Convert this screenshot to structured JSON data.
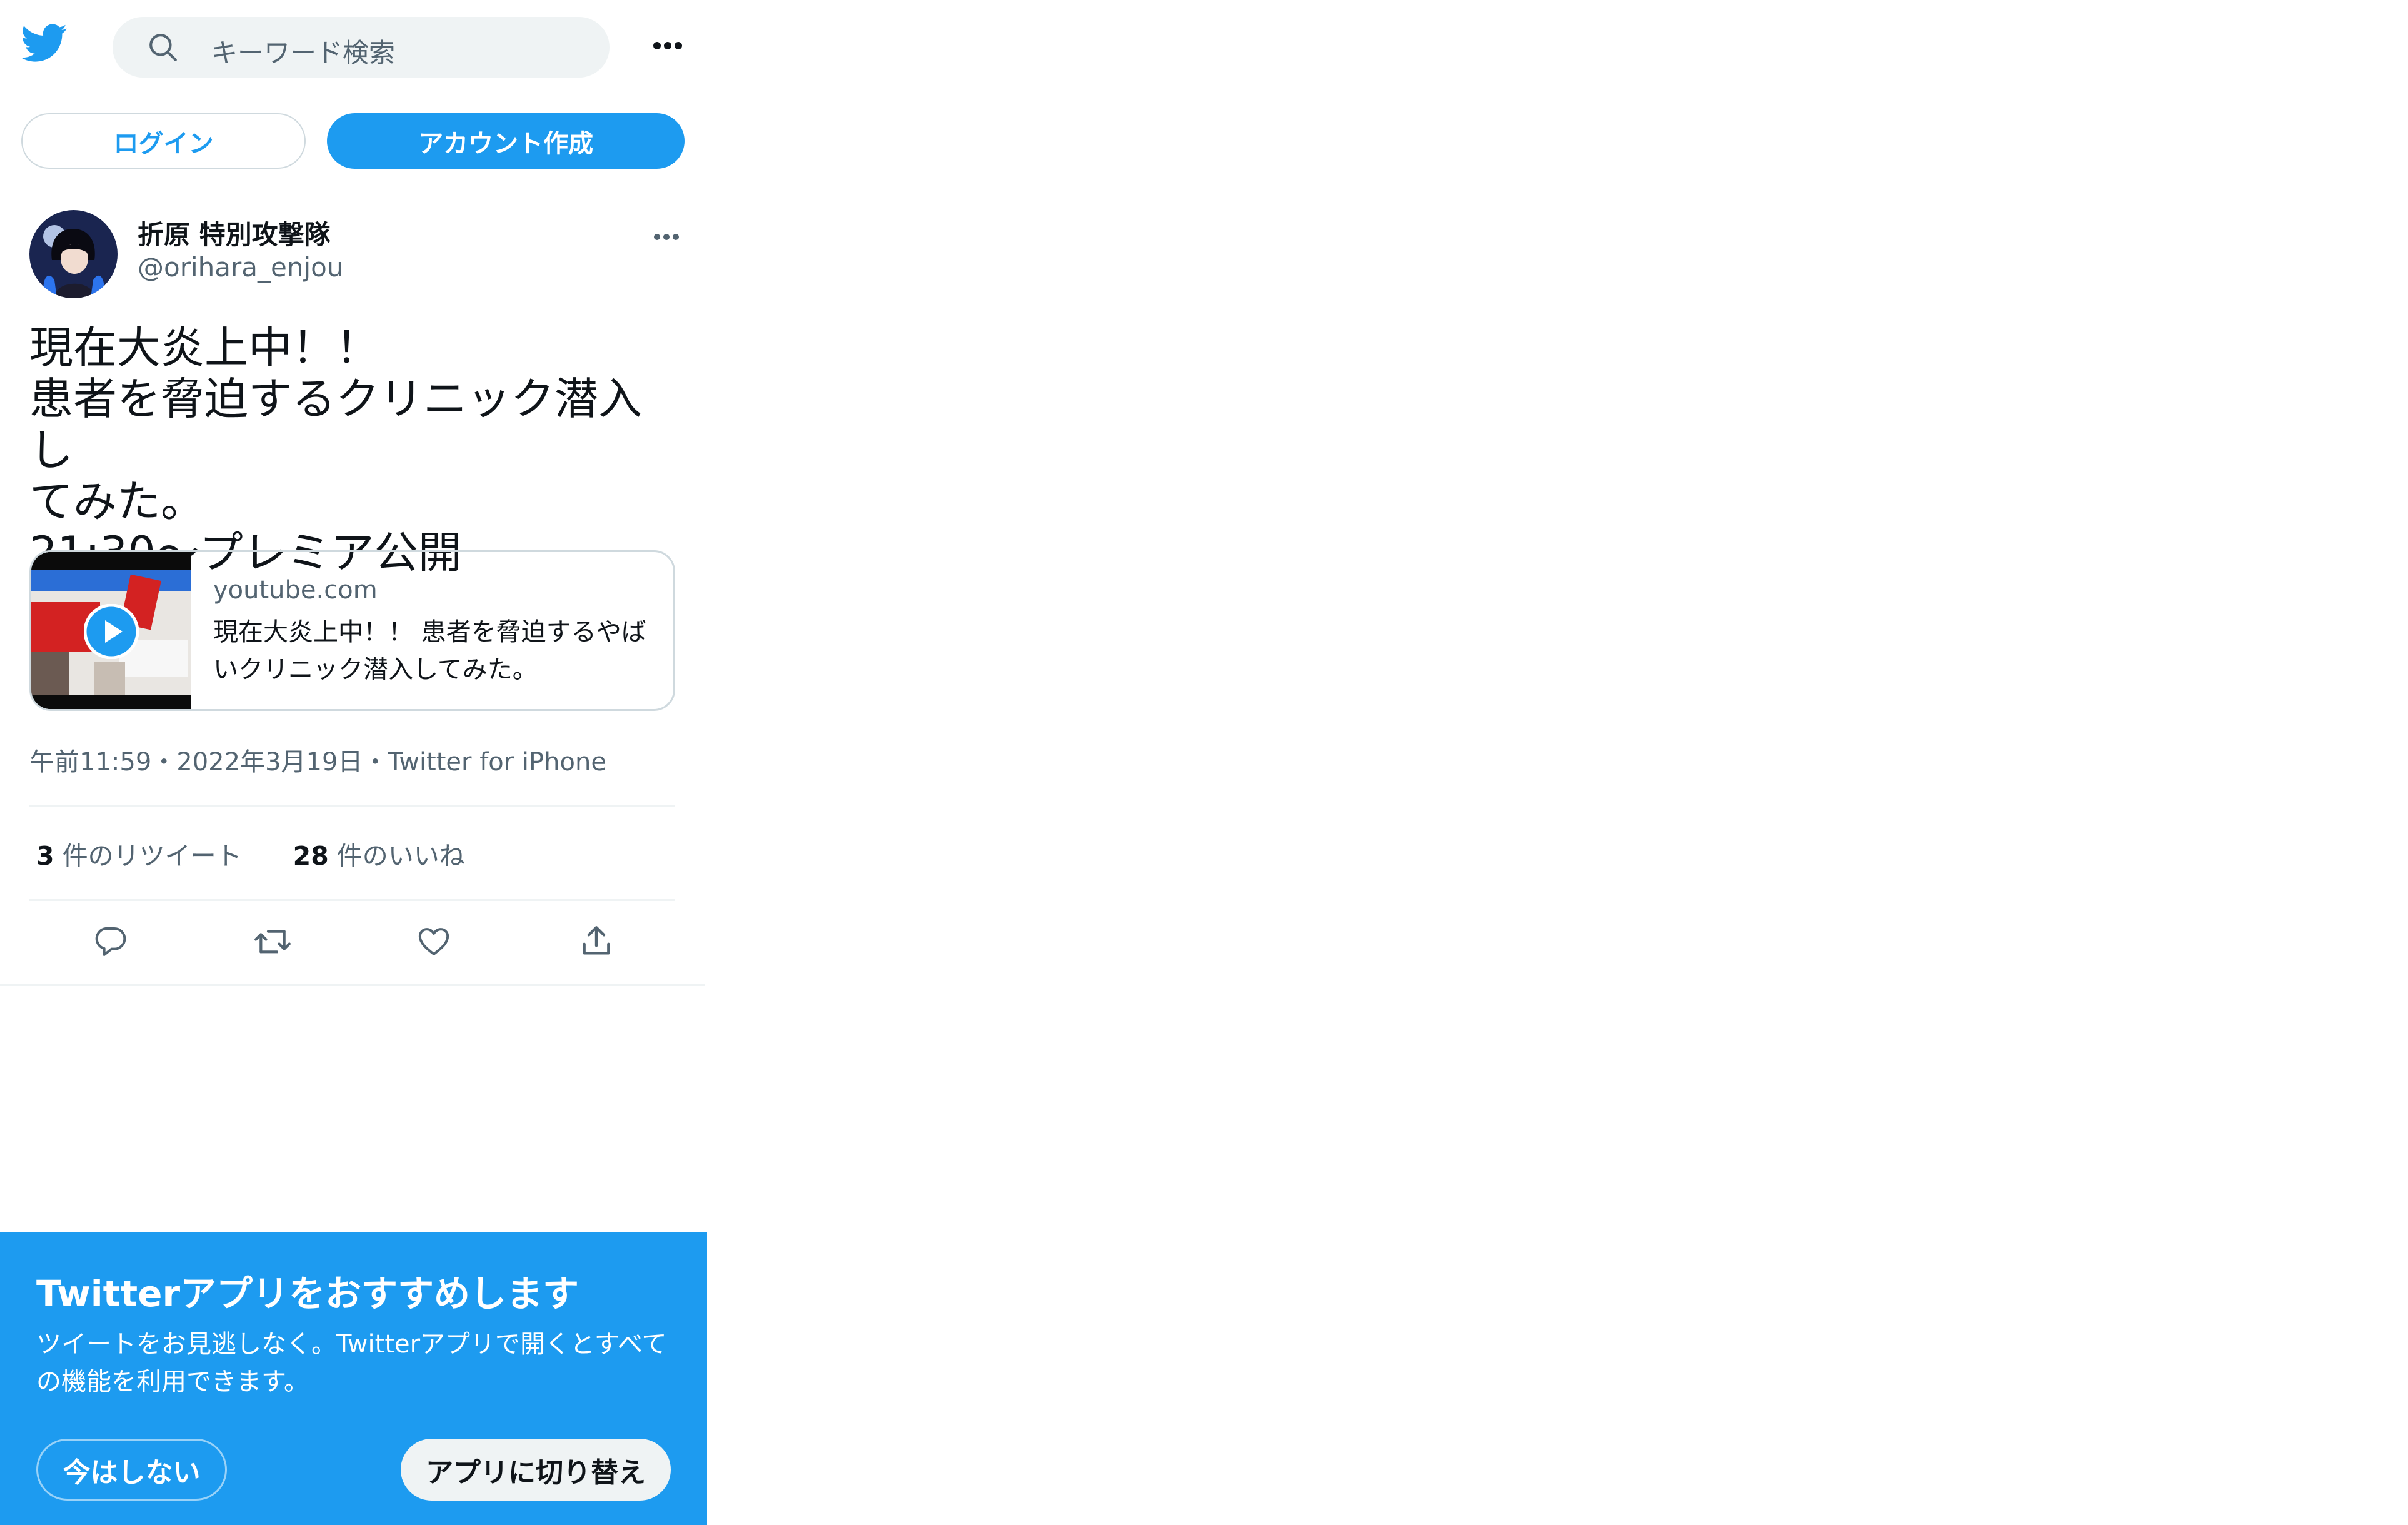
{
  "header": {
    "search_placeholder": "キーワード検索",
    "brand_color": "#1d9bf0"
  },
  "auth": {
    "login_label": "ログイン",
    "signup_label": "アカウント作成"
  },
  "tweet": {
    "display_name": "折原 特別攻撃隊",
    "handle": "@orihara_enjou",
    "text": "現在大炎上中！！\n患者を脅迫するクリニック潜入し\nてみた。\n21:30〜プレミア公開",
    "card": {
      "domain": "youtube.com",
      "title": "現在大炎上中！！ 患者を脅迫するやばいクリニック潜入してみた。"
    },
    "timestamp": "午前11:59・2022年3月19日・Twitter for iPhone",
    "retweet_count": "3",
    "retweet_label": "件のリツイート",
    "like_count": "28",
    "like_label": "件のいいね",
    "actions": [
      "reply",
      "retweet",
      "like",
      "share"
    ]
  },
  "promo": {
    "title": "Twitterアプリをおすすめします",
    "body": "ツイートをお見逃しなく。Twitterアプリで開くとすべての機能を利用できます。",
    "not_now_label": "今はしない",
    "switch_label": "アプリに切り替え"
  }
}
